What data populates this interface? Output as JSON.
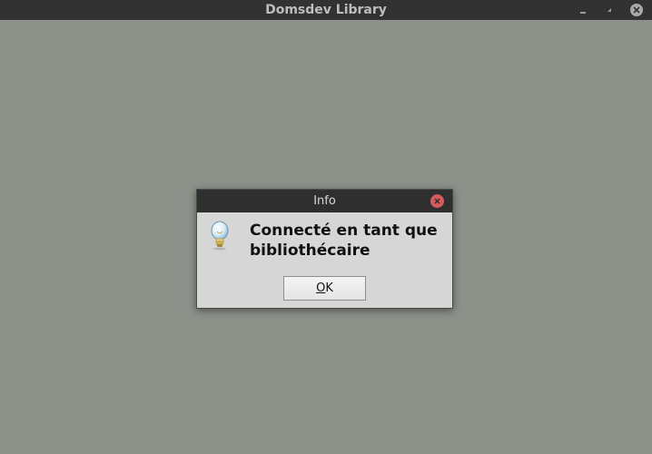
{
  "window": {
    "title": "Domsdev Library",
    "controls": [
      "minimize-icon",
      "maximize-icon",
      "close-icon"
    ]
  },
  "dialog": {
    "title": "Info",
    "icon": "lightbulb-icon",
    "message_line1": "Connecté en tant que",
    "message_line2": "bibliothécaire",
    "ok_mnemonic": "O",
    "ok_rest": "K"
  },
  "colors": {
    "desktop_background": "#8c918a",
    "titlebar": "#323232",
    "dialog_background": "#d6d6d6",
    "dialog_close": "#d35b5b"
  }
}
